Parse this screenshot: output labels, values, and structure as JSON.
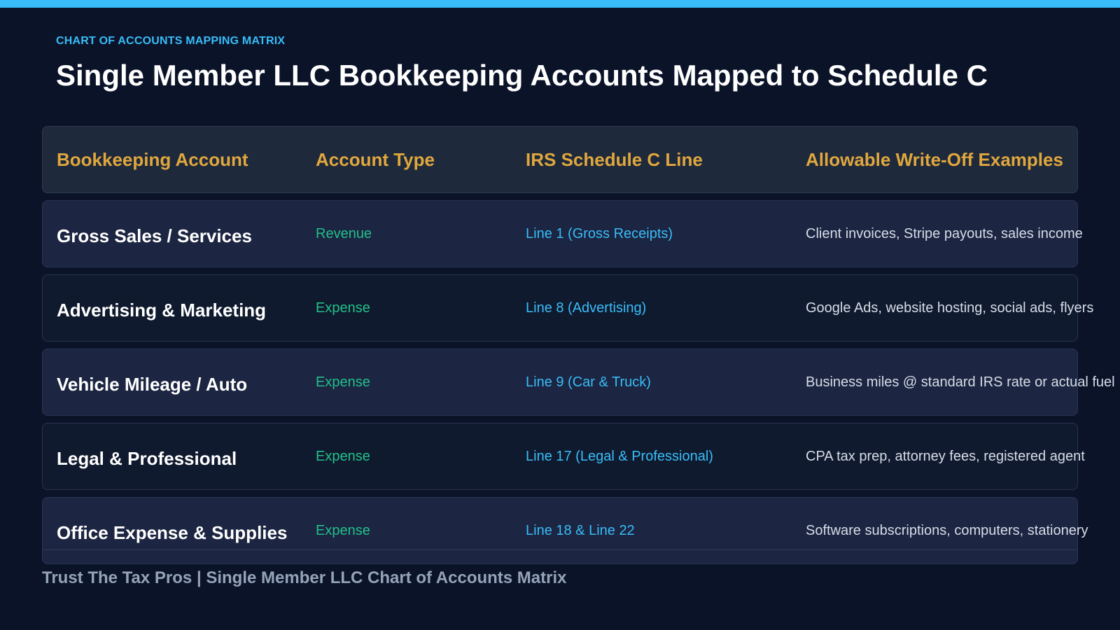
{
  "colors": {
    "background": "#0b1329",
    "accent_bar": "#38bdf8",
    "header_text": "#e0a73e",
    "type_text": "#22c08a",
    "line_text": "#38bdf8"
  },
  "eyebrow": "CHART OF ACCOUNTS MAPPING MATRIX",
  "title": "Single Member LLC Bookkeeping Accounts Mapped to Schedule C",
  "table": {
    "headers": [
      "Bookkeeping Account",
      "Account Type",
      "IRS Schedule C Line",
      "Allowable Write-Off Examples"
    ],
    "rows": [
      {
        "account": "Gross Sales / Services",
        "type": "Revenue",
        "line": "Line 1 (Gross Receipts)",
        "examples": "Client invoices, Stripe payouts, sales income"
      },
      {
        "account": "Advertising & Marketing",
        "type": "Expense",
        "line": "Line 8 (Advertising)",
        "examples": "Google Ads, website hosting, social ads, flyers"
      },
      {
        "account": "Vehicle Mileage / Auto",
        "type": "Expense",
        "line": "Line 9 (Car & Truck)",
        "examples": "Business miles @ standard IRS rate or actual fuel"
      },
      {
        "account": "Legal & Professional",
        "type": "Expense",
        "line": "Line 17 (Legal & Professional)",
        "examples": "CPA tax prep, attorney fees, registered agent"
      },
      {
        "account": "Office Expense & Supplies",
        "type": "Expense",
        "line": "Line 18 & Line 22",
        "examples": "Software subscriptions, computers, stationery"
      }
    ]
  },
  "footer": "Trust The Tax Pros | Single Member LLC Chart of Accounts Matrix"
}
